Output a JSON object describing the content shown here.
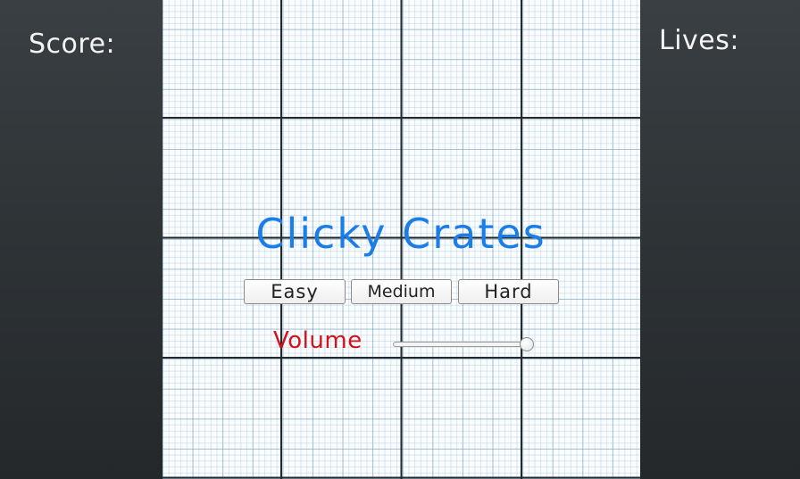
{
  "hud": {
    "score_label": "Score:",
    "lives_label": "Lives:"
  },
  "menu": {
    "title": "Clicky Crates",
    "buttons": [
      {
        "label": "Easy"
      },
      {
        "label": "Medium"
      },
      {
        "label": "Hard"
      }
    ]
  },
  "volume": {
    "label": "Volume",
    "level": 1.0
  },
  "colors": {
    "title": "#1a7de8",
    "volume_label": "#d4121b",
    "side_panels": "#2f3437",
    "play_area": "#fafcfd",
    "grid_major": "#23292d",
    "grid_minor": "#78a0b9"
  }
}
